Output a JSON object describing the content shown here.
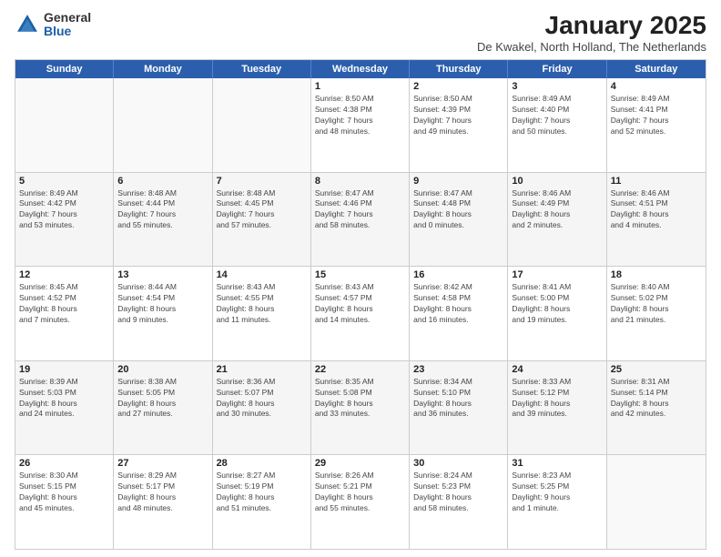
{
  "logo": {
    "general": "General",
    "blue": "Blue"
  },
  "title": "January 2025",
  "subtitle": "De Kwakel, North Holland, The Netherlands",
  "days_of_week": [
    "Sunday",
    "Monday",
    "Tuesday",
    "Wednesday",
    "Thursday",
    "Friday",
    "Saturday"
  ],
  "weeks": [
    {
      "shaded": false,
      "days": [
        {
          "num": "",
          "info": ""
        },
        {
          "num": "",
          "info": ""
        },
        {
          "num": "",
          "info": ""
        },
        {
          "num": "1",
          "info": "Sunrise: 8:50 AM\nSunset: 4:38 PM\nDaylight: 7 hours\nand 48 minutes."
        },
        {
          "num": "2",
          "info": "Sunrise: 8:50 AM\nSunset: 4:39 PM\nDaylight: 7 hours\nand 49 minutes."
        },
        {
          "num": "3",
          "info": "Sunrise: 8:49 AM\nSunset: 4:40 PM\nDaylight: 7 hours\nand 50 minutes."
        },
        {
          "num": "4",
          "info": "Sunrise: 8:49 AM\nSunset: 4:41 PM\nDaylight: 7 hours\nand 52 minutes."
        }
      ]
    },
    {
      "shaded": true,
      "days": [
        {
          "num": "5",
          "info": "Sunrise: 8:49 AM\nSunset: 4:42 PM\nDaylight: 7 hours\nand 53 minutes."
        },
        {
          "num": "6",
          "info": "Sunrise: 8:48 AM\nSunset: 4:44 PM\nDaylight: 7 hours\nand 55 minutes."
        },
        {
          "num": "7",
          "info": "Sunrise: 8:48 AM\nSunset: 4:45 PM\nDaylight: 7 hours\nand 57 minutes."
        },
        {
          "num": "8",
          "info": "Sunrise: 8:47 AM\nSunset: 4:46 PM\nDaylight: 7 hours\nand 58 minutes."
        },
        {
          "num": "9",
          "info": "Sunrise: 8:47 AM\nSunset: 4:48 PM\nDaylight: 8 hours\nand 0 minutes."
        },
        {
          "num": "10",
          "info": "Sunrise: 8:46 AM\nSunset: 4:49 PM\nDaylight: 8 hours\nand 2 minutes."
        },
        {
          "num": "11",
          "info": "Sunrise: 8:46 AM\nSunset: 4:51 PM\nDaylight: 8 hours\nand 4 minutes."
        }
      ]
    },
    {
      "shaded": false,
      "days": [
        {
          "num": "12",
          "info": "Sunrise: 8:45 AM\nSunset: 4:52 PM\nDaylight: 8 hours\nand 7 minutes."
        },
        {
          "num": "13",
          "info": "Sunrise: 8:44 AM\nSunset: 4:54 PM\nDaylight: 8 hours\nand 9 minutes."
        },
        {
          "num": "14",
          "info": "Sunrise: 8:43 AM\nSunset: 4:55 PM\nDaylight: 8 hours\nand 11 minutes."
        },
        {
          "num": "15",
          "info": "Sunrise: 8:43 AM\nSunset: 4:57 PM\nDaylight: 8 hours\nand 14 minutes."
        },
        {
          "num": "16",
          "info": "Sunrise: 8:42 AM\nSunset: 4:58 PM\nDaylight: 8 hours\nand 16 minutes."
        },
        {
          "num": "17",
          "info": "Sunrise: 8:41 AM\nSunset: 5:00 PM\nDaylight: 8 hours\nand 19 minutes."
        },
        {
          "num": "18",
          "info": "Sunrise: 8:40 AM\nSunset: 5:02 PM\nDaylight: 8 hours\nand 21 minutes."
        }
      ]
    },
    {
      "shaded": true,
      "days": [
        {
          "num": "19",
          "info": "Sunrise: 8:39 AM\nSunset: 5:03 PM\nDaylight: 8 hours\nand 24 minutes."
        },
        {
          "num": "20",
          "info": "Sunrise: 8:38 AM\nSunset: 5:05 PM\nDaylight: 8 hours\nand 27 minutes."
        },
        {
          "num": "21",
          "info": "Sunrise: 8:36 AM\nSunset: 5:07 PM\nDaylight: 8 hours\nand 30 minutes."
        },
        {
          "num": "22",
          "info": "Sunrise: 8:35 AM\nSunset: 5:08 PM\nDaylight: 8 hours\nand 33 minutes."
        },
        {
          "num": "23",
          "info": "Sunrise: 8:34 AM\nSunset: 5:10 PM\nDaylight: 8 hours\nand 36 minutes."
        },
        {
          "num": "24",
          "info": "Sunrise: 8:33 AM\nSunset: 5:12 PM\nDaylight: 8 hours\nand 39 minutes."
        },
        {
          "num": "25",
          "info": "Sunrise: 8:31 AM\nSunset: 5:14 PM\nDaylight: 8 hours\nand 42 minutes."
        }
      ]
    },
    {
      "shaded": false,
      "days": [
        {
          "num": "26",
          "info": "Sunrise: 8:30 AM\nSunset: 5:15 PM\nDaylight: 8 hours\nand 45 minutes."
        },
        {
          "num": "27",
          "info": "Sunrise: 8:29 AM\nSunset: 5:17 PM\nDaylight: 8 hours\nand 48 minutes."
        },
        {
          "num": "28",
          "info": "Sunrise: 8:27 AM\nSunset: 5:19 PM\nDaylight: 8 hours\nand 51 minutes."
        },
        {
          "num": "29",
          "info": "Sunrise: 8:26 AM\nSunset: 5:21 PM\nDaylight: 8 hours\nand 55 minutes."
        },
        {
          "num": "30",
          "info": "Sunrise: 8:24 AM\nSunset: 5:23 PM\nDaylight: 8 hours\nand 58 minutes."
        },
        {
          "num": "31",
          "info": "Sunrise: 8:23 AM\nSunset: 5:25 PM\nDaylight: 9 hours\nand 1 minute."
        },
        {
          "num": "",
          "info": ""
        }
      ]
    }
  ]
}
